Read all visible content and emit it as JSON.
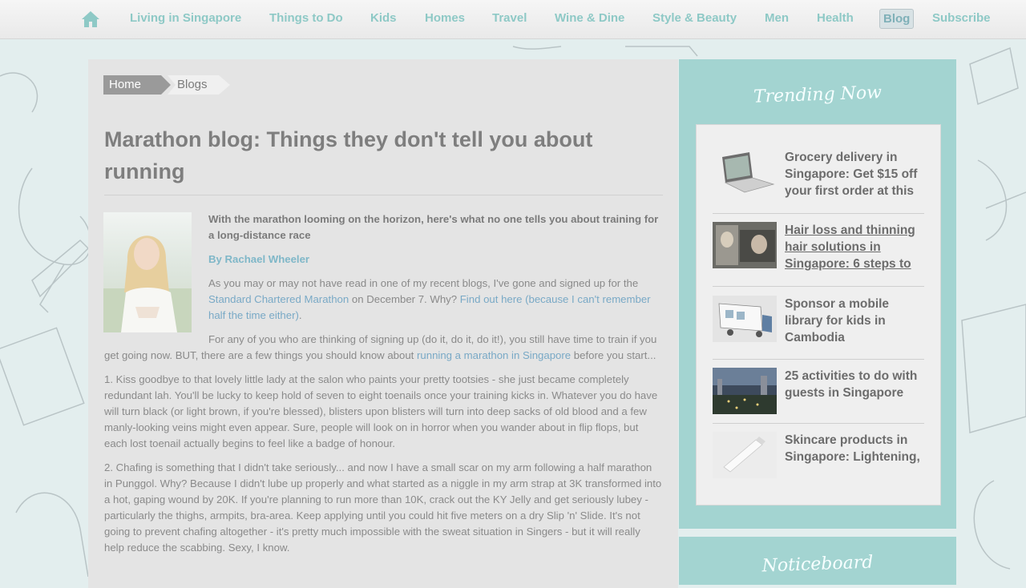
{
  "nav": {
    "items": [
      "Living in Singapore",
      "Things to Do",
      "Kids",
      "Homes",
      "Travel",
      "Wine & Dine",
      "Style & Beauty",
      "Men",
      "Health",
      "Blog",
      "Subscribe"
    ],
    "active": "Blog"
  },
  "breadcrumb": {
    "home": "Home",
    "current": "Blogs"
  },
  "article": {
    "title": "Marathon blog: Things they don't tell you about running",
    "lead": "With the marathon looming on the horizon, here's what no one tells you about training for a long-distance race",
    "byline": "By Rachael Wheeler",
    "p1": {
      "a": "As you may or may not have read in one of my recent blogs, I've gone and signed up for the ",
      "link1": "Standard Chartered Marathon",
      "b": " on December 7. Why? ",
      "link2": "Find out here (because I can't remember half the time either)",
      "c": "."
    },
    "p2": {
      "a": "For any of you who are thinking of signing up (do it, do it, do it!), you still have time to train if you get going now. BUT, there are a few things you should know about ",
      "link": "running a marathon in Singapore",
      "b": " before you start..."
    },
    "p3": "1. Kiss goodbye to that lovely little lady at the salon who paints your pretty tootsies - she just became completely redundant lah. You'll be lucky to keep hold of seven to eight toenails once your training kicks in. Whatever you do have will turn black (or light brown, if you're blessed), blisters upon blisters will turn into deep sacks of old blood and a few manly-looking veins might even appear. Sure, people will look on in horror when you wander about in flip flops, but each lost toenail actually begins to feel like a badge of honour.",
    "p4": "2. Chafing is something that I didn't take seriously... and now I have a small scar on my arm following a half marathon in Punggol. Why? Because I didn't lube up properly and what started as a niggle in my arm strap at 3K transformed into a hot, gaping wound by 20K. If you're planning to run more than 10K, crack out the KY Jelly and get seriously lubey - particularly the thighs, armpits, bra-area. Keep applying until you could hit five meters on a dry Slip 'n' Slide. It's not going to prevent chafing altogether - it's pretty much impossible with the sweat situation in Singers - but it will really help reduce the scabbing. Sexy, I know."
  },
  "sidebar": {
    "heading": "Trending Now",
    "items": [
      {
        "title": "Grocery delivery in Singapore: Get $15 off your first order at this",
        "thumb": "laptop-icon"
      },
      {
        "title": "Hair loss and thinning hair solutions in Singapore: 6 steps to",
        "thumb": "salon-photo"
      },
      {
        "title": "Sponsor a mobile library for kids in Cambodia",
        "thumb": "truck-photo"
      },
      {
        "title": "25 activities to do with guests in Singapore",
        "thumb": "city-night-photo"
      },
      {
        "title": "Skincare products in Singapore: Lightening,",
        "thumb": "skincare-photo"
      }
    ],
    "notice_heading": "Noticeboard"
  },
  "colors": {
    "accent": "#a3d4d1",
    "nav_text": "#8ec9c6",
    "link": "#79a9c6"
  }
}
